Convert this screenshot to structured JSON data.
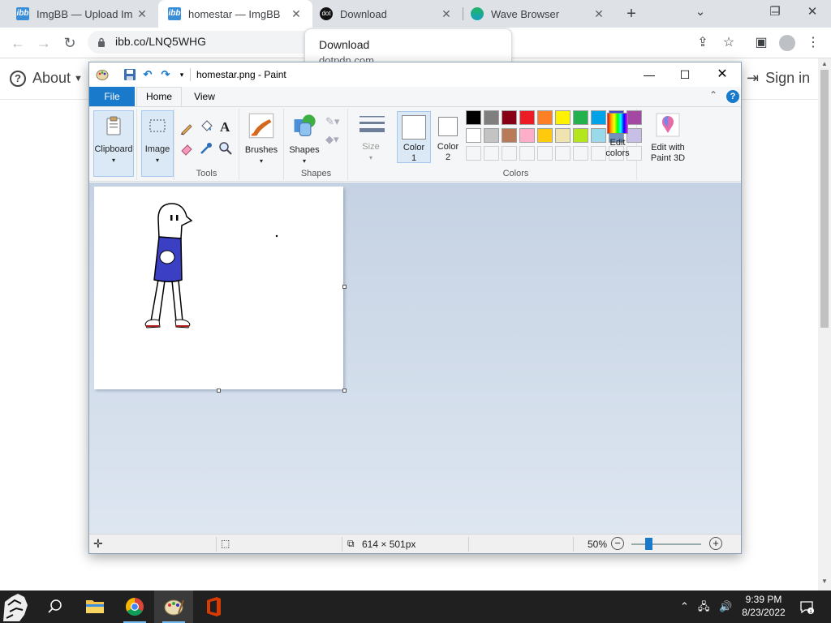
{
  "browser": {
    "tabs": [
      {
        "title": "ImgBB — Upload Imag",
        "favicon": "ibb-favicon",
        "active": false
      },
      {
        "title": "homestar — ImgBB",
        "favicon": "ibb-favicon",
        "active": true
      },
      {
        "title": "Download",
        "favicon": "dotpdn-favicon",
        "active": false
      },
      {
        "title": "Wave Browser",
        "favicon": "wave-favicon",
        "active": false
      }
    ],
    "favicon_text": {
      "ibb": "ibb",
      "dot": "dot"
    },
    "url": "ibb.co/LNQ5WHG",
    "download_popup": {
      "title": "Download",
      "subtitle": "dotpdn.com"
    }
  },
  "page": {
    "about_label": "About",
    "signin_label": "Sign in"
  },
  "paint": {
    "title": "homestar.png - Paint",
    "ribbon_tabs": [
      "File",
      "Home",
      "View"
    ],
    "groups": {
      "clipboard": "Clipboard",
      "image": "Image",
      "tools": "Tools",
      "brushes": "Brushes",
      "shapes": "Shapes",
      "shapes_group": "Shapes",
      "size": "Size",
      "color1": [
        "Color",
        "1"
      ],
      "color2": [
        "Color",
        "2"
      ],
      "edit_colors": [
        "Edit",
        "colors"
      ],
      "paint3d": [
        "Edit with",
        "Paint 3D"
      ],
      "colors_group": "Colors"
    },
    "palette_row1": [
      "#000000",
      "#7f7f7f",
      "#880015",
      "#ed1c24",
      "#ff7f27",
      "#fff200",
      "#22b14c",
      "#00a2e8",
      "#3f48cc",
      "#a349a4"
    ],
    "palette_row2": [
      "#ffffff",
      "#c3c3c3",
      "#b97a57",
      "#ffaec9",
      "#ffc90e",
      "#efe4b0",
      "#b5e61d",
      "#99d9ea",
      "#7092be",
      "#c8bfe7"
    ],
    "status": {
      "dimensions": "614 × 501px",
      "zoom": "50%"
    }
  },
  "taskbar": {
    "time": "9:39 PM",
    "date": "8/23/2022"
  },
  "colors": {
    "accent": "#1979ca",
    "shirt": "#3b3fc4"
  }
}
